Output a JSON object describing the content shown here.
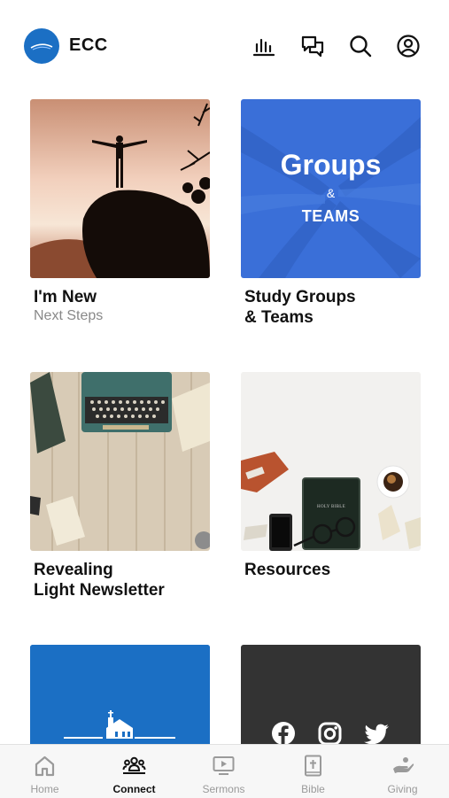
{
  "header": {
    "app_name": "ECC",
    "icons": [
      "stats-icon",
      "chat-icon",
      "search-icon",
      "account-icon"
    ]
  },
  "cards": [
    {
      "title": "I'm New",
      "subtitle": "Next Steps",
      "image": "person-on-rock-sunset"
    },
    {
      "title": "Study Groups\n& Teams",
      "image": "groups-teams-hands",
      "image_text": {
        "line1": "Groups",
        "line2": "&",
        "line3": "TEAMS"
      }
    },
    {
      "title": "Revealing\nLight Newsletter",
      "image": "typewriter-desk"
    },
    {
      "title": "Resources",
      "image": "bible-glasses-coffee",
      "image_text": {
        "book": "HOLY BIBLE"
      }
    },
    {
      "title": "",
      "image": "church-banner"
    },
    {
      "title": "",
      "image": "social-icons"
    }
  ],
  "nav": {
    "items": [
      {
        "label": "Home",
        "icon": "home-icon"
      },
      {
        "label": "Connect",
        "icon": "people-icon",
        "active": true
      },
      {
        "label": "Sermons",
        "icon": "video-icon"
      },
      {
        "label": "Bible",
        "icon": "bible-icon"
      },
      {
        "label": "Giving",
        "icon": "hand-icon"
      }
    ]
  },
  "colors": {
    "accent": "#1b6fc4",
    "groups_blue": "#3a6fd8",
    "dark_tile": "#333333"
  }
}
